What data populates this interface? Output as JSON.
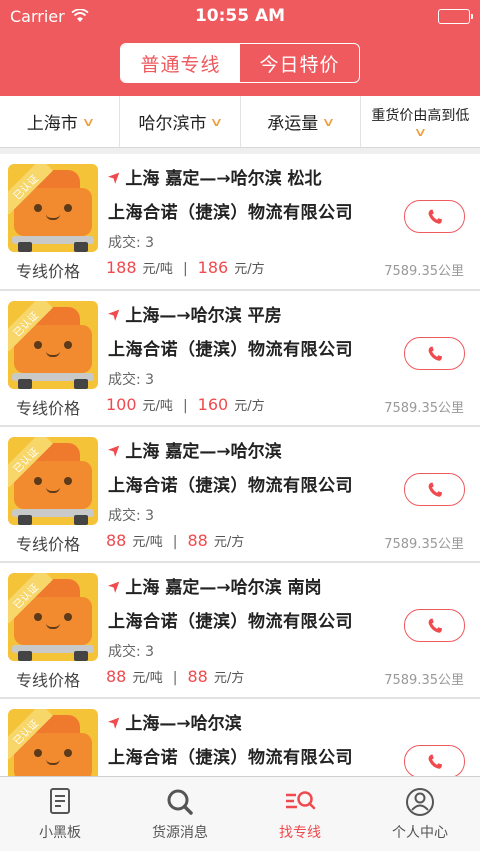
{
  "status": {
    "carrier": "Carrier",
    "time": "10:55 AM"
  },
  "segment": {
    "options": [
      "普通专线",
      "今日特价"
    ],
    "active": 0
  },
  "filters": {
    "origin": "上海市",
    "destination": "哈尔滨市",
    "capacity": "承运量",
    "sort": "重货价由高到低"
  },
  "common": {
    "price_label": "专线价格",
    "unit_ton": "元/吨",
    "unit_cube": "元/方",
    "separator": "|",
    "badge": "已认证"
  },
  "cards": [
    {
      "route": "上海 嘉定—→哈尔滨 松北",
      "company": "上海合诺（捷滨）物流有限公司",
      "deals": "成交: 3",
      "price_ton": "188",
      "price_cube": "186",
      "distance": "7589.35公里"
    },
    {
      "route": "上海—→哈尔滨 平房",
      "company": "上海合诺（捷滨）物流有限公司",
      "deals": "成交: 3",
      "price_ton": "100",
      "price_cube": "160",
      "distance": "7589.35公里"
    },
    {
      "route": "上海 嘉定—→哈尔滨",
      "company": "上海合诺（捷滨）物流有限公司",
      "deals": "成交: 3",
      "price_ton": "88",
      "price_cube": "88",
      "distance": "7589.35公里"
    },
    {
      "route": "上海 嘉定—→哈尔滨 南岗",
      "company": "上海合诺（捷滨）物流有限公司",
      "deals": "成交: 3",
      "price_ton": "88",
      "price_cube": "88",
      "distance": "7589.35公里"
    },
    {
      "route": "上海—→哈尔滨",
      "company": "上海合诺（捷滨）物流有限公司",
      "deals": "",
      "price_ton": "",
      "price_cube": "",
      "distance": ""
    }
  ],
  "tabbar": {
    "items": [
      {
        "label": "小黑板",
        "icon": "notepad-icon"
      },
      {
        "label": "货源消息",
        "icon": "search-icon"
      },
      {
        "label": "找专线",
        "icon": "route-search-icon"
      },
      {
        "label": "个人中心",
        "icon": "user-icon"
      }
    ],
    "active": 2
  },
  "colors": {
    "brand": "#ef5a5f",
    "accent_chevron": "#ef9d3a",
    "price": "#ef4b4f"
  }
}
